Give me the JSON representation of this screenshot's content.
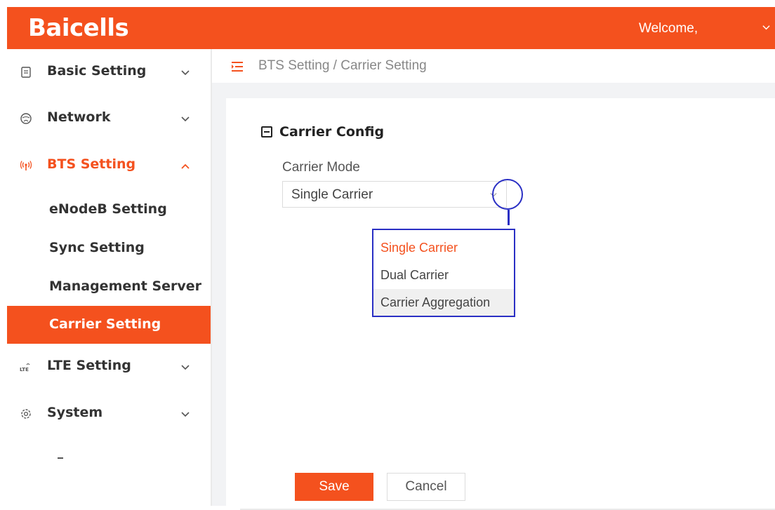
{
  "header": {
    "logo_text": "Baicells",
    "welcome_text": "Welcome,",
    "color": "#f4511e"
  },
  "sidebar": {
    "items": [
      {
        "label": "Basic Setting",
        "icon": "document-icon",
        "expanded": false
      },
      {
        "label": "Network",
        "icon": "globe-icon",
        "expanded": false
      },
      {
        "label": "BTS Setting",
        "icon": "antenna-icon",
        "expanded": true,
        "children": [
          {
            "label": "eNodeB Setting"
          },
          {
            "label": "Sync Setting"
          },
          {
            "label": "Management Server"
          },
          {
            "label": "Carrier Setting",
            "selected": true
          }
        ]
      },
      {
        "label": "LTE Setting",
        "icon": "lte-icon",
        "expanded": false
      },
      {
        "label": "System",
        "icon": "gear-icon",
        "expanded": false
      }
    ],
    "trailing_mark": "-"
  },
  "breadcrumb": {
    "text": "BTS Setting / Carrier Setting"
  },
  "section": {
    "title": "Carrier Config"
  },
  "carrier_mode": {
    "label": "Carrier Mode",
    "value": "Single Carrier",
    "options": [
      "Single Carrier",
      "Dual Carrier",
      "Carrier Aggregation"
    ]
  },
  "buttons": {
    "save": "Save",
    "cancel": "Cancel"
  },
  "colors": {
    "accent": "#f4511e",
    "annotation": "#2a2fc4"
  }
}
